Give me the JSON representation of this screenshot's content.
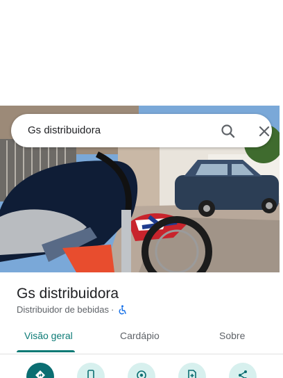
{
  "search": {
    "query": "Gs distribuidora",
    "search_icon": "search-icon",
    "close_icon": "close-icon"
  },
  "place": {
    "name": "Gs distribuidora",
    "category": "Distribuidor de bebidas",
    "separator": "·",
    "accessibility_icon": "wheelchair-icon"
  },
  "tabs": [
    {
      "label": "Visão geral",
      "active": true
    },
    {
      "label": "Cardápio",
      "active": false
    },
    {
      "label": "Sobre",
      "active": false
    }
  ],
  "actions": [
    {
      "icon": "directions-icon"
    },
    {
      "icon": "phone-icon"
    },
    {
      "icon": "nearby-icon"
    },
    {
      "icon": "save-icon"
    },
    {
      "icon": "share-icon"
    }
  ],
  "colors": {
    "accent": "#0b7a75",
    "action_bg": "#d7f0ee"
  }
}
